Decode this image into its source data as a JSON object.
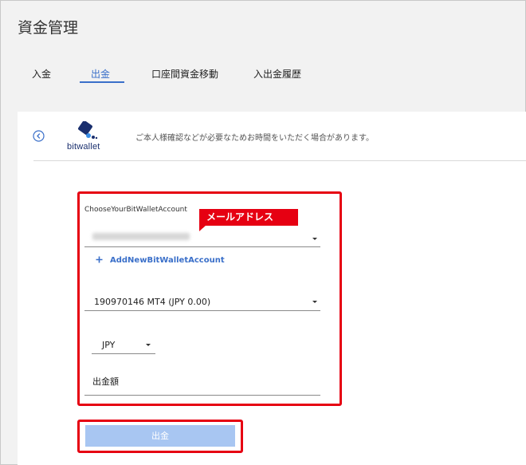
{
  "page": {
    "title": "資金管理"
  },
  "tabs": [
    {
      "label": "入金",
      "active": false
    },
    {
      "label": "出金",
      "active": true
    },
    {
      "label": "口座間資金移動",
      "active": false
    },
    {
      "label": "入出金履歴",
      "active": false
    }
  ],
  "card": {
    "back_icon": "chevron-left-circle-icon",
    "logo_text": "bitwallet",
    "notice": "ご本人様確認などが必要なためお時間をいただく場合があります。"
  },
  "form": {
    "account_label": "ChooseYourBitWalletAccount",
    "email_callout": "メールアドレス",
    "add_account_link": "AddNewBitWalletAccount",
    "trading_account": "190970146 MT4 (JPY 0.00)",
    "currency": "JPY",
    "amount_placeholder": "出金額",
    "submit_label": "出金"
  },
  "colors": {
    "accent": "#3a6fc9",
    "highlight": "#e60012",
    "button": "#a8c6f2"
  }
}
